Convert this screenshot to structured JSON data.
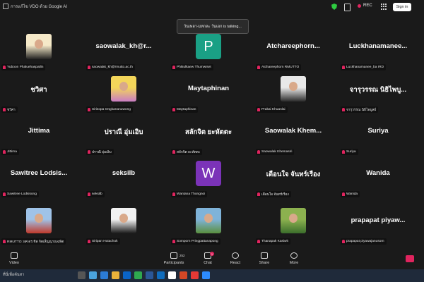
{
  "window": {
    "title": "การแก้ไข VDO ด้วย Google AI",
    "rec_label": "REC",
    "signin_label": "Sign in"
  },
  "talking": "วันเพลา-มหกละ วันเอก is talking...",
  "participants": [
    {
      "id": "t1",
      "kind": "photo",
      "display": "",
      "label": "Yuboon Phaluehaspailin",
      "photo_colors": [
        "#f5e9c8",
        "#222"
      ]
    },
    {
      "id": "t2",
      "kind": "name",
      "display": "saowalak_kh@r...",
      "label": "saowalak_kh@rmutto.ac.th"
    },
    {
      "id": "t3",
      "kind": "letter",
      "display": "P",
      "label": "Phikulkaew Thumwiset",
      "color": "#1aa085"
    },
    {
      "id": "t4",
      "kind": "name",
      "display": "Atchareephorn...",
      "label": "Atchareephorn RMUTTO"
    },
    {
      "id": "t5",
      "kind": "name",
      "display": "Luckhanamanee...",
      "label": "Luckhanamanee_ba IRD"
    },
    {
      "id": "t6",
      "kind": "name",
      "display": "ชวิศา",
      "label": "ชวิศา"
    },
    {
      "id": "t7",
      "kind": "photo",
      "display": "",
      "label": "Sirisopa Ongkananuwong",
      "photo_colors": [
        "#f3d65a",
        "#c97cc4"
      ]
    },
    {
      "id": "t8",
      "kind": "name",
      "display": "Maytaphinan",
      "label": "Maytaphinan"
    },
    {
      "id": "t9",
      "kind": "photo",
      "display": "",
      "label": "Prakai Khuanlai",
      "photo_colors": [
        "#e9e9e9",
        "#2a2a2a"
      ]
    },
    {
      "id": "t10",
      "kind": "name",
      "display": "จารุวรรณ นิธิไพบู...",
      "label": "จารุวรรณ นิธิไพบูลย์"
    },
    {
      "id": "t11",
      "kind": "name",
      "display": "Jittima",
      "label": "Jittima"
    },
    {
      "id": "t12",
      "kind": "name",
      "display": "ปราณี อุ่มเอิบ",
      "label": "ปราณี อุ่มเอิบ"
    },
    {
      "id": "t13",
      "kind": "name",
      "display": "สลักจิต ยะหัตตะ",
      "label": "สลักจิต ยะหัตตะ"
    },
    {
      "id": "t14",
      "kind": "name",
      "display": "Saowalak Khem...",
      "label": "Saowalak Khemasiri"
    },
    {
      "id": "t15",
      "kind": "name",
      "display": "Suriya",
      "label": "Suriya"
    },
    {
      "id": "t16",
      "kind": "name",
      "display": "Sawitree Lodsis...",
      "label": "Sawitree Lodsisong"
    },
    {
      "id": "t17",
      "kind": "name",
      "display": "seksilb",
      "label": "seksilb"
    },
    {
      "id": "t18",
      "kind": "letter",
      "display": "W",
      "label": "Wantana Thongnoi",
      "color": "#7b33b8"
    },
    {
      "id": "t19",
      "kind": "name",
      "display": "เดือนใจ จันทร์เรือง",
      "label": "เดือนใจ จันทร์เรือง"
    },
    {
      "id": "t20",
      "kind": "name",
      "display": "Wanida",
      "label": "Wanida"
    },
    {
      "id": "t21",
      "kind": "photo",
      "display": "",
      "label": "RMUTTO: ผศ.ดร.ชิด จิตเส็ญญาณฉพิต",
      "photo_colors": [
        "#9fc3e8",
        "#c0392b"
      ]
    },
    {
      "id": "t22",
      "kind": "photo",
      "display": "",
      "label": "Siripan Hutachok",
      "photo_colors": [
        "#f2f2f2",
        "#1a1a1a"
      ]
    },
    {
      "id": "t23",
      "kind": "photo",
      "display": "",
      "label": "Somporn Pringpattanapong",
      "photo_colors": [
        "#7fb3d9",
        "#5a8f3e"
      ]
    },
    {
      "id": "t24",
      "kind": "photo",
      "display": "",
      "label": "Thanapak Kasiwit",
      "photo_colors": [
        "#8cb14f",
        "#3b6e2c"
      ]
    },
    {
      "id": "t25",
      "kind": "name",
      "display": "prapapat piyaw...",
      "label": "prapapat piyawajanusorn"
    }
  ],
  "toolbar": {
    "video": "Video",
    "participants": "Participants",
    "participant_count": "252",
    "chat": "Chat",
    "chat_badge": "1",
    "react": "React",
    "share": "Share",
    "more": "More"
  },
  "taskbar": {
    "search_placeholder": "ที่นี่เพื่อค้นหา",
    "time": "",
    "date": ""
  }
}
